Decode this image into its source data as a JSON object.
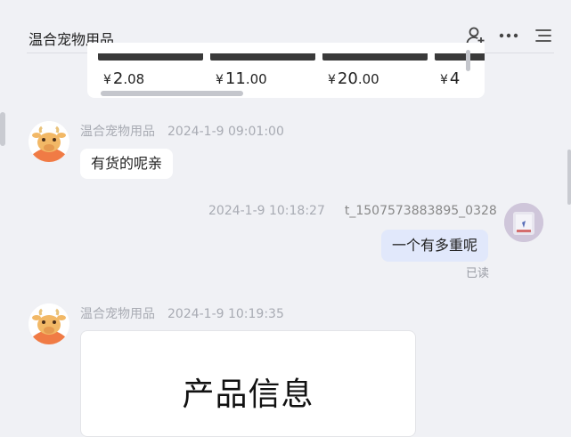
{
  "header": {
    "title": "温合宠物用品",
    "icons": [
      "add-user-icon",
      "more-icon",
      "menu-icon"
    ]
  },
  "product_card": {
    "items": [
      {
        "price_int": "2",
        "price_dec": ".08"
      },
      {
        "price_int": "11",
        "price_dec": ".00"
      },
      {
        "price_int": "20",
        "price_dec": ".00"
      },
      {
        "price_int": "4",
        "price_dec": ""
      }
    ],
    "currency": "¥"
  },
  "messages": [
    {
      "sender": "温合宠物用品",
      "time": "2024-1-9 09:01:00",
      "text": "有货的呢亲",
      "side": "left"
    },
    {
      "sender": "t_1507573883895_0328",
      "time": "2024-1-9 10:18:27",
      "text": "一个有多重呢",
      "status": "已读",
      "side": "right"
    },
    {
      "sender": "温合宠物用品",
      "time": "2024-1-9 10:19:35",
      "card_title": "产品信息",
      "side": "left"
    }
  ],
  "colors": {
    "background": "#f0f1f5",
    "bubble_self": "#e1e8fb",
    "bubble_other": "#ffffff",
    "meta_text": "#a8abb3"
  }
}
